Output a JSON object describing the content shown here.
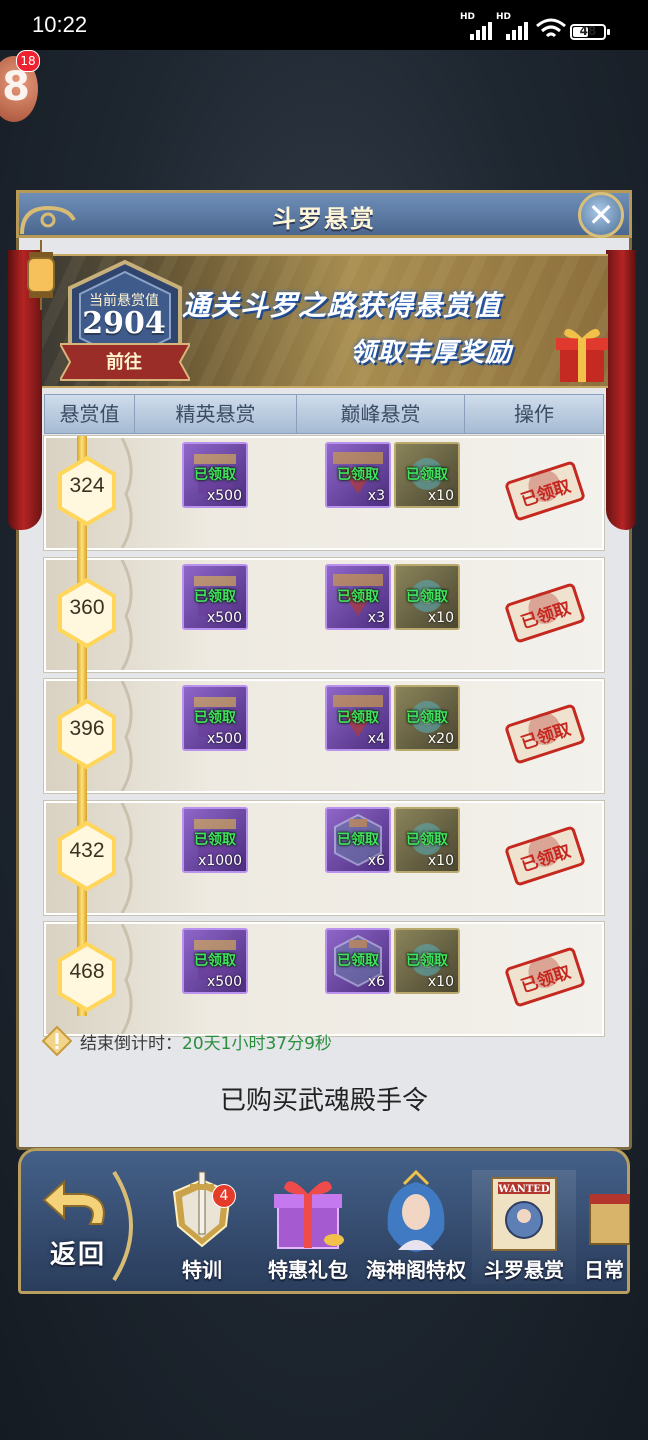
{
  "status_bar": {
    "time": "10:22",
    "signal1": "HD",
    "signal2": "HD",
    "battery": "48"
  },
  "floating": {
    "badge": "18",
    "glyph": "8"
  },
  "panel": {
    "title": "斗罗悬赏",
    "close": "✕"
  },
  "banner": {
    "emblem_label": "当前悬赏值",
    "emblem_value": "2904",
    "goto": "前往",
    "line1": "通关斗罗之路获得悬赏值",
    "line2": "领取丰厚奖励"
  },
  "table": {
    "headers": [
      "悬赏值",
      "精英悬赏",
      "巅峰悬赏",
      "操作"
    ],
    "claimed_text": "已领取",
    "stamp_text": "已领取",
    "rows": [
      {
        "value": "324",
        "elite_qty": "x500",
        "peak1_qty": "x3",
        "peak2_qty": "x10"
      },
      {
        "value": "360",
        "elite_qty": "x500",
        "peak1_qty": "x3",
        "peak2_qty": "x10"
      },
      {
        "value": "396",
        "elite_qty": "x500",
        "peak1_qty": "x4",
        "peak2_qty": "x20"
      },
      {
        "value": "432",
        "elite_qty": "x1000",
        "peak1_qty": "x6",
        "peak2_qty": "x10"
      },
      {
        "value": "468",
        "elite_qty": "x500",
        "peak1_qty": "x6",
        "peak2_qty": "x10"
      }
    ]
  },
  "countdown": {
    "label": "结束倒计时：",
    "value": "20天1小时37分9秒"
  },
  "purchased": "已购买武魂殿手令",
  "bottom_nav": {
    "back": "返回",
    "items": [
      {
        "label": "特训",
        "badge": "4"
      },
      {
        "label": "特惠礼包"
      },
      {
        "label": "海神阁特权"
      },
      {
        "label": "斗罗悬赏"
      },
      {
        "label": "日常"
      }
    ]
  },
  "colors": {
    "claimed_green": "#41e35d",
    "countdown_green": "#2a8f3c",
    "stamp_red": "#c5281f",
    "gold": "#ffe27a"
  }
}
